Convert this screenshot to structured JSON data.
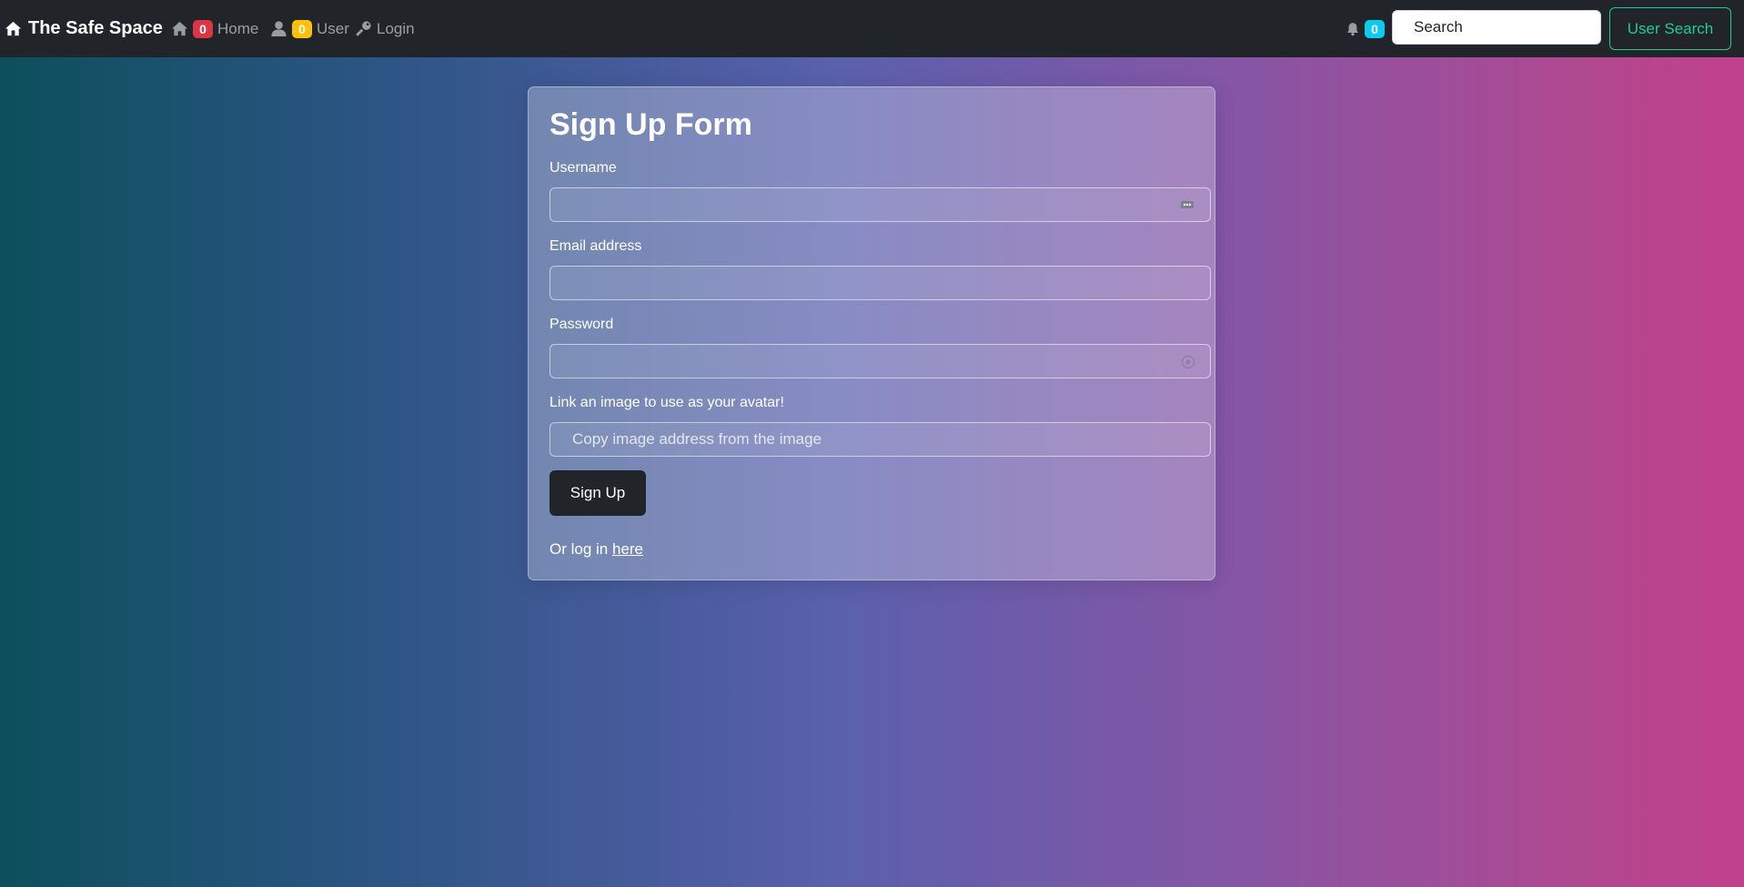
{
  "navbar": {
    "brand": "The Safe Space",
    "home": {
      "label": "Home",
      "count": "0",
      "badge_color": "#dc3545"
    },
    "user": {
      "label": "User",
      "count": "0",
      "badge_color": "#ffc107"
    },
    "login": {
      "label": "Login"
    },
    "notifications": {
      "count": "0",
      "badge_color": "#0dcaf0"
    },
    "search": {
      "placeholder": "Search"
    },
    "search_button": "User Search"
  },
  "form": {
    "title": "Sign Up Form",
    "username_label": "Username",
    "email_label": "Email address",
    "password_label": "Password",
    "avatar_label": "Link an image to use as your avatar!",
    "avatar_placeholder": "Copy image address from the image",
    "submit_label": "Sign Up",
    "login_prefix": "Or log in ",
    "login_link": "here"
  },
  "colors": {
    "navbar_bg": "#212529",
    "search_button_accent": "#20c997"
  }
}
